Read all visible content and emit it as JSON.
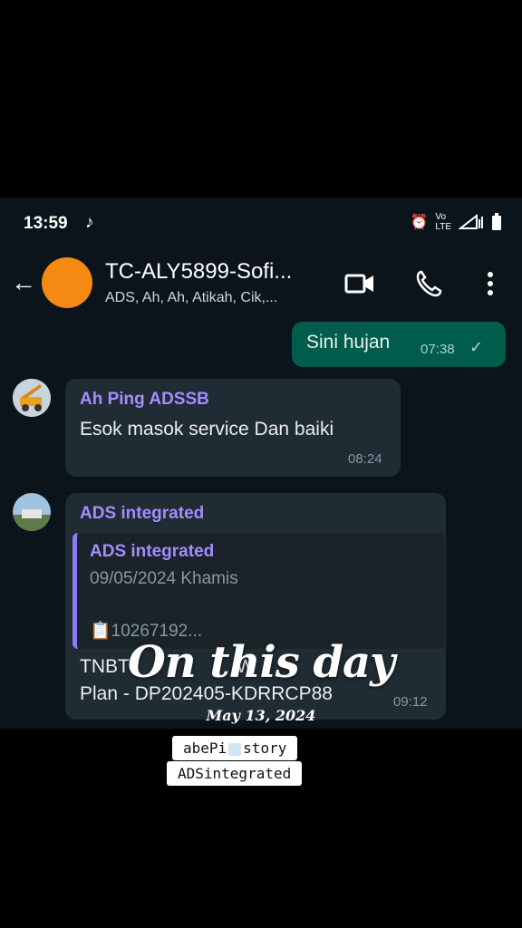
{
  "status_bar": {
    "time": "13:59",
    "tiktok_icon": "tiktok-icon",
    "icons": [
      "alarm-icon",
      "volte-icon",
      "signal-icon",
      "battery-icon"
    ]
  },
  "header": {
    "title": "TC-ALY5899-Sofi...",
    "subtitle": "ADS, Ah, Ah, Atikah, Cik,...",
    "avatar_color": "#f58a12"
  },
  "messages": [
    {
      "type": "outgoing",
      "text": "Sini hujan",
      "time": "07:38",
      "status": "✓"
    },
    {
      "type": "incoming",
      "sender": "Ah Ping ADSSB",
      "text": "Esok masok service Dan baiki",
      "time": "08:24"
    },
    {
      "type": "incoming",
      "sender": "ADS integrated",
      "quoted": {
        "sender": "ADS integrated",
        "line": "09/05/2024 Khamis",
        "doc": "10267192..."
      },
      "text_line1": "TNBT",
      "text_line1_rest": "W",
      "text_line2": "Plan - DP202405-KDRRCP88",
      "time": "09:12"
    }
  ],
  "overlay": {
    "title": "On this day",
    "date": "May 13, 2024",
    "sticker_line1": "abePi",
    "sticker_line1_end": "story",
    "sticker_line2": "ADSintegrated"
  },
  "colors": {
    "chat_bg": "#0b141a",
    "outgoing": "#005c4b",
    "incoming": "#202c33",
    "sender": "#a48cff"
  }
}
